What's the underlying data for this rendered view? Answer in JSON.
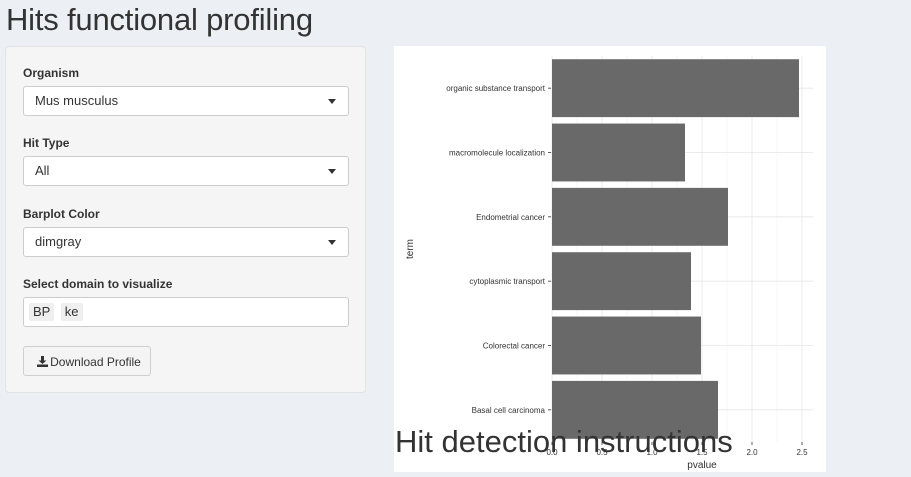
{
  "header": {
    "title": "Hits functional profiling"
  },
  "sidebar": {
    "organism": {
      "label": "Organism",
      "value": "Mus musculus"
    },
    "hit_type": {
      "label": "Hit Type",
      "value": "All"
    },
    "barplot_color": {
      "label": "Barplot Color",
      "value": "dimgray"
    },
    "domain": {
      "label": "Select domain to visualize",
      "chips": [
        "BP",
        "ke"
      ]
    },
    "download_label": "Download Profile"
  },
  "section2_title": "Hit detection instructions",
  "chart_data": {
    "type": "bar",
    "orientation": "horizontal",
    "categories": [
      "organic substance transport",
      "macromolecule localization",
      "Endometrial cancer",
      "cytoplasmic transport",
      "Colorectal cancer",
      "Basal cell carcinoma"
    ],
    "values": [
      2.47,
      1.33,
      1.76,
      1.39,
      1.49,
      1.66
    ],
    "xlabel": "pvalue",
    "ylabel": "term",
    "xlim": [
      0,
      2.6
    ],
    "xticks": [
      "0.0",
      "0.5",
      "1.0",
      "1.5",
      "2.0",
      "2.5"
    ],
    "bar_color": "#696969",
    "grid": true
  }
}
